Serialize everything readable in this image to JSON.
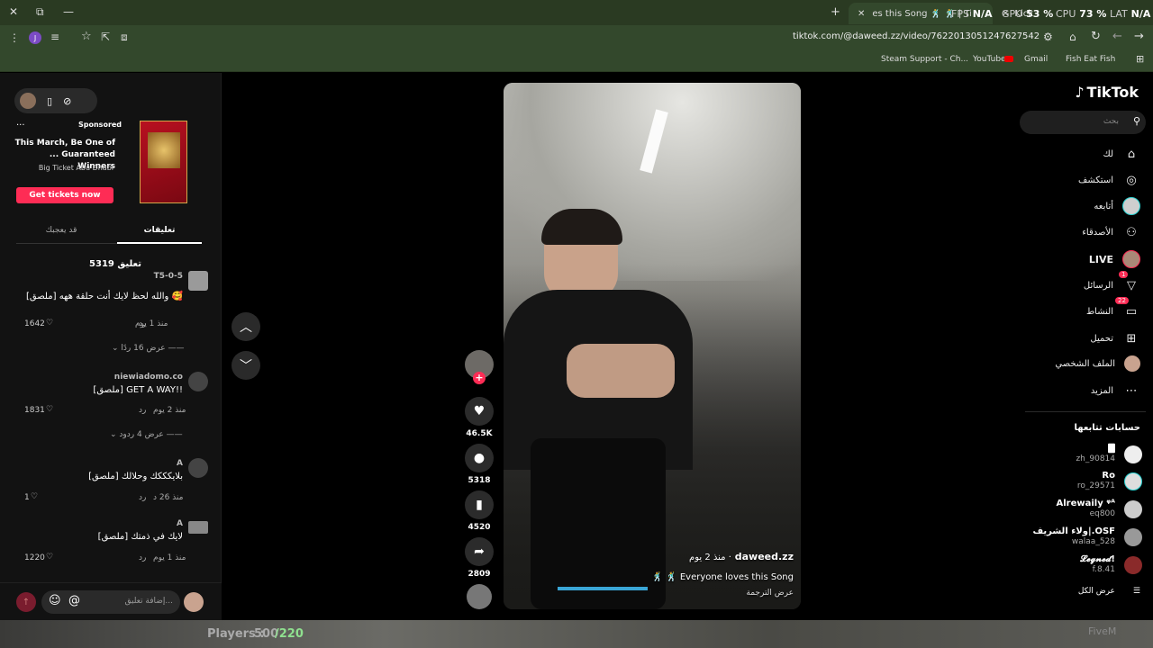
{
  "browser": {
    "window_buttons": [
      "✕",
      "⧉",
      "—"
    ],
    "tabs": [
      {
        "label": "es this Song 🕺 🕺 | TikTok"
      },
      {
        "label": "Kick"
      }
    ],
    "new_tab": "+",
    "url": "tiktok.com/@daweed.zz/video/7622013051247627542",
    "avatar_letter": "J",
    "bookmarks": [
      {
        "label": "Steam Support - Ch..."
      },
      {
        "label": "YouTube"
      },
      {
        "label": "Gmail"
      },
      {
        "label": "Fish Eat Fish"
      }
    ]
  },
  "overlay": {
    "fps_label": "FPS",
    "fps": "N/A",
    "gpu_label": "GPU",
    "gpu": "53 %",
    "cpu_label": "CPU",
    "cpu": "73 %",
    "lat_label": "LAT",
    "lat": "N/A"
  },
  "left": {
    "ad": {
      "sponsored": "Sponsored",
      "title": "This March, Be One of ... Guaranteed Winners",
      "brand": "Big Ticket Abu Dhabi",
      "cta": "Get tickets now",
      "more": "..."
    },
    "tabs": {
      "comments": "تعليقات",
      "you_may_like": "قد يعجبك"
    },
    "comment_count": "5319 تعليق",
    "comments": [
      {
        "user": "T5-0-5",
        "text": "[ملصق] والله لحظ لايك أنت حلقة ههه 🥰",
        "time": "منذ 1 يوم",
        "reply": "رد",
        "likes": "1642",
        "replies": "عرض 16 ردًا"
      },
      {
        "user": "niewiadomo.co",
        "text": "[ملصق] GET A WAY!!",
        "time": "منذ 2 يوم",
        "reply": "رد",
        "likes": "1831",
        "replies": "عرض 4 ردود"
      },
      {
        "user": "A",
        "text": "[ملصق] بلايكككك وحلالك",
        "time": "منذ 26 د",
        "reply": "رد",
        "likes": "1",
        "replies": ""
      },
      {
        "user": "A",
        "text": "[ملصق] لايك في ذمتك",
        "time": "منذ 1 يوم",
        "reply": "رد",
        "likes": "1220",
        "replies": ""
      }
    ],
    "input_placeholder": "إضافة تعليق...",
    "at": "@"
  },
  "video": {
    "username": "daweed.zz",
    "time": "منذ 2 يوم ·",
    "caption": "🕺 🕺 Everyone loves this Song",
    "translate": "عرض الترجمة",
    "likes": "46.5K",
    "comments": "5318",
    "saves": "4520",
    "shares": "2809"
  },
  "right": {
    "logo": "TikTok",
    "search_placeholder": "بحث",
    "nav": [
      {
        "label": "لك",
        "icon": "home-icon"
      },
      {
        "label": "استكشف",
        "icon": "compass-icon"
      },
      {
        "label": "أتابعه",
        "icon": "following-icon"
      },
      {
        "label": "الأصدقاء",
        "icon": "friends-icon"
      },
      {
        "label": "LIVE",
        "icon": "live-icon"
      },
      {
        "label": "الرسائل",
        "icon": "send-icon",
        "badge": "1"
      },
      {
        "label": "النشاط",
        "icon": "activity-icon",
        "badge": "22"
      },
      {
        "label": "تحميل",
        "icon": "upload-icon"
      },
      {
        "label": "الملف الشخصي",
        "icon": "profile-icon"
      },
      {
        "label": "المزيد",
        "icon": "more-icon"
      }
    ],
    "following_title": "حسابات تتابعها",
    "following": [
      {
        "name": "🀫",
        "handle": "zh_90814"
      },
      {
        "name": "Ro",
        "handle": "ro_29571"
      },
      {
        "name": "Alrewaily ᵠᴬ",
        "handle": "eq800"
      },
      {
        "name": "ولاء الشريف|.OSF",
        "handle": "walaa_528"
      },
      {
        "name": "𝓛𝓮𝓰𝓷𝓮𝓭!",
        "handle": "f.8.41"
      }
    ],
    "show_all": "عرض الكل"
  },
  "game": {
    "players_label": "Players :",
    "players_current": "500",
    "players_max": "/220",
    "fivem": "FiveM"
  }
}
